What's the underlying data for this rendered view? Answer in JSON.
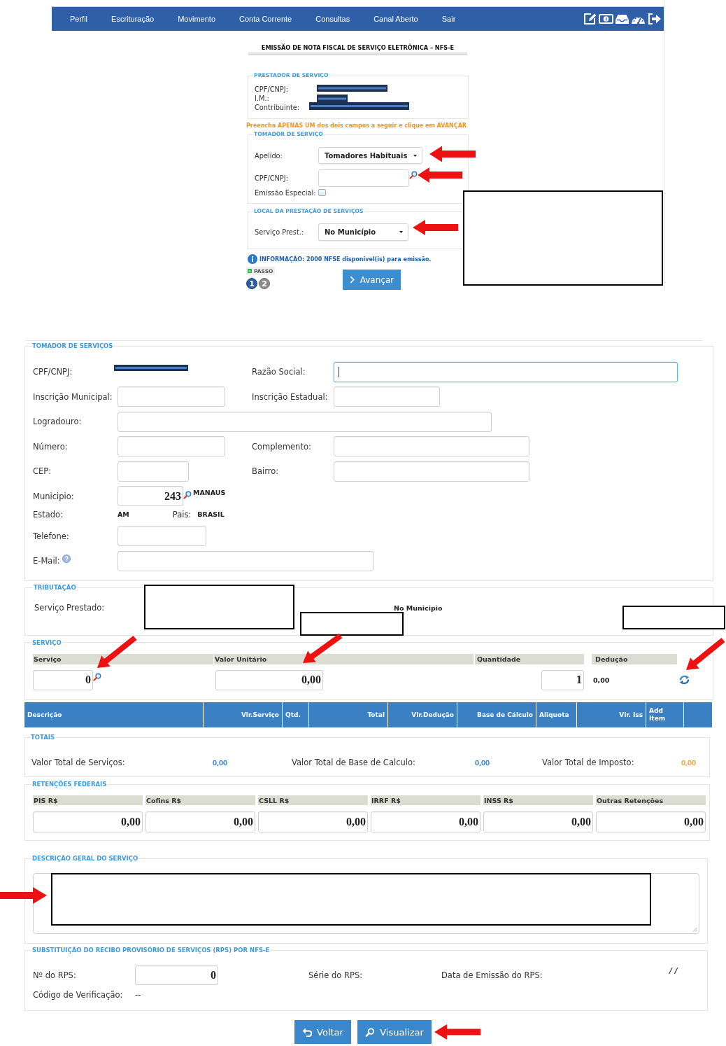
{
  "top_screen": {
    "nav": {
      "items": [
        "Perfil",
        "Escrituração",
        "Movimento",
        "Conta Corrente",
        "Consultas",
        "Canal Aberto",
        "Sair"
      ]
    },
    "title": "EMISSÃO DE NOTA FISCAL DE SERVIÇO ELETRÔNICA – NFS-E",
    "provider": {
      "legend": "PRESTADOR DE SERVIÇO",
      "rows": [
        {
          "label": "CPF/CNPJ:",
          "redacted": true
        },
        {
          "label": "I.M.:",
          "redacted": true
        },
        {
          "label": "Contribuinte:",
          "redacted": true
        }
      ]
    },
    "notice": "Preencha APENAS UM dos dois campos a seguir e clique em AVANÇAR",
    "taker": {
      "legend": "TOMADOR DE SERVIÇO",
      "nickname": {
        "label": "Apelido:",
        "value": "Tomadores Habituais"
      },
      "cpf_cnpj": {
        "label": "CPF/CNPJ:"
      },
      "special_issue": {
        "label": "Emissão Especial:",
        "checked": false
      }
    },
    "location": {
      "legend": "LOCAL DA PRESTAÇÃO DE SERVIÇOS",
      "service_place": {
        "label": "Serviço Prest.:",
        "value": "No Município"
      }
    },
    "info": "INFORMAÇÃO: 2000 NFSE disponivel(is) para emissão.",
    "steps": {
      "label": "PASSO",
      "items": [
        {
          "label": "1",
          "selected": true
        },
        {
          "label": "2",
          "selected": false
        }
      ]
    },
    "next_button": "Avançar"
  },
  "form": {
    "taker": {
      "legend": "TOMADOR DE SERVIÇOS",
      "cpf_cnpj": {
        "label": "CPF/CNPJ:",
        "redacted": true
      },
      "company_name": {
        "label": "Razão Social:",
        "focused": true
      },
      "municipal_reg": {
        "label": "Inscrição Municipal:"
      },
      "state_reg": {
        "label": "Inscrição Estadual:"
      },
      "street": {
        "label": "Logradouro:"
      },
      "number": {
        "label": "Número:"
      },
      "complement": {
        "label": "Complemento:"
      },
      "zip": {
        "label": "CEP:"
      },
      "district": {
        "label": "Bairro:"
      },
      "city": {
        "label": "Municipio:",
        "code": "243",
        "name": "MANAUS"
      },
      "state": {
        "label": "Estado:",
        "value": "AM"
      },
      "country": {
        "label": "Pais:",
        "value": "BRASIL"
      },
      "phone": {
        "label": "Telefone:"
      },
      "email": {
        "label": "E-Mail:"
      }
    },
    "taxation": {
      "legend": "TRIBUTAÇÃO",
      "label": "Serviço Prestado:",
      "value": "No Municipio"
    },
    "service": {
      "legend": "SERVIÇO",
      "columns": [
        "Serviço",
        "Valor Unitário",
        "Quantidade",
        "Dedução"
      ],
      "service_code": "0",
      "unit_value": "0,00",
      "quantity": "1",
      "deduction": "0,00"
    },
    "items_table": {
      "columns": [
        "Descrição",
        "Vlr.Serviço",
        "Qtd.",
        "Total",
        "Vlr.Dedução",
        "Base de Cálculo",
        "Aliquota",
        "Vlr. Iss",
        "Add Item"
      ]
    },
    "totals": {
      "legend": "TOTAIS",
      "items": [
        {
          "label": "Valor Total de Serviços:",
          "value": "0,00",
          "color": "#2f80d8"
        },
        {
          "label": "Valor Total de Base de Calculo:",
          "value": "0,00",
          "color": "#2f80d8"
        },
        {
          "label": "Valor Total de Imposto:",
          "value": "0,00",
          "color": "#f2a040"
        }
      ]
    },
    "retentions": {
      "legend": "RETENÇÕES FEDERAIS",
      "columns": [
        "PIS R$",
        "Cofins R$",
        "CSLL R$",
        "IRRF R$",
        "INSS R$",
        "Outras Retenções"
      ],
      "values": [
        "0,00",
        "0,00",
        "0,00",
        "0,00",
        "0,00",
        "0,00"
      ]
    },
    "description": {
      "legend": "DESCRIÇÃO GERAL DO SERVIÇO"
    },
    "rps": {
      "legend": "SUBSTITUIÇÃO DO RECIBO PROVISÓRIO DE SERVIÇOS (RPS) POR NFS-E",
      "number": {
        "label": "Nº do RPS:",
        "value": "0"
      },
      "series": {
        "label": "Série do RPS:"
      },
      "issue_date": {
        "label": "Data de Emissão do RPS:",
        "value": "/ /"
      },
      "verification_code": {
        "label": "Código de Verificação:",
        "value": "--"
      }
    },
    "buttons": [
      {
        "label": "Voltar",
        "kind": "back"
      },
      {
        "label": "Visualizar",
        "kind": "view"
      }
    ]
  }
}
